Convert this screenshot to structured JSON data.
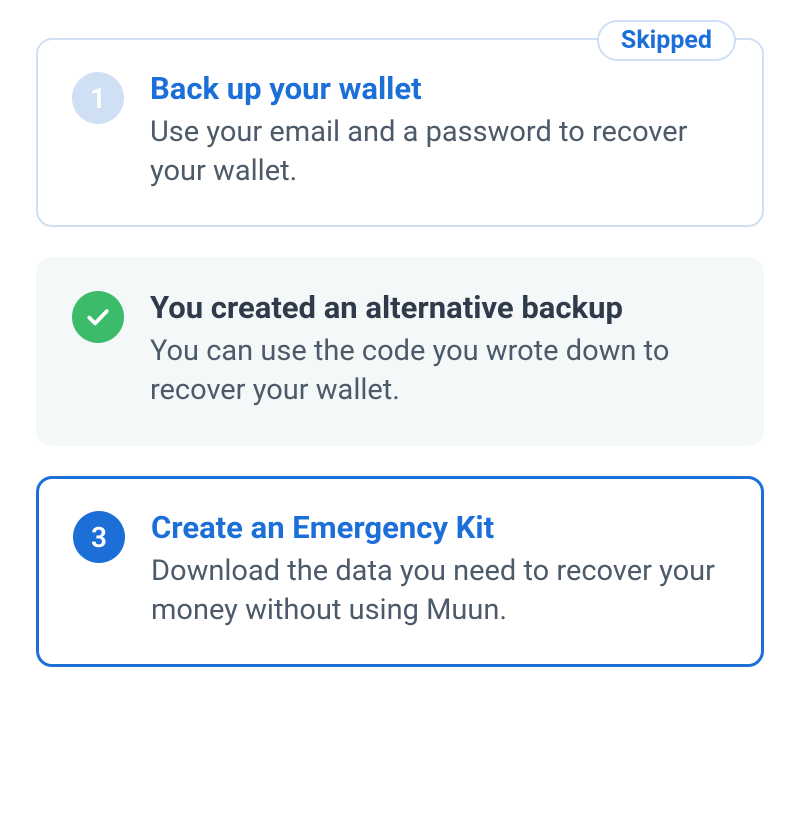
{
  "steps": [
    {
      "number": "1",
      "status_label": "Skipped",
      "title": "Back up your wallet",
      "description": "Use your email and a password to recover your wallet."
    },
    {
      "title": "You created an alternative backup",
      "description": "You can use the code you wrote down to recover your wallet."
    },
    {
      "number": "3",
      "title": "Create an Emergency Kit",
      "description": "Download the data you need to recover your money without using Muun."
    }
  ]
}
